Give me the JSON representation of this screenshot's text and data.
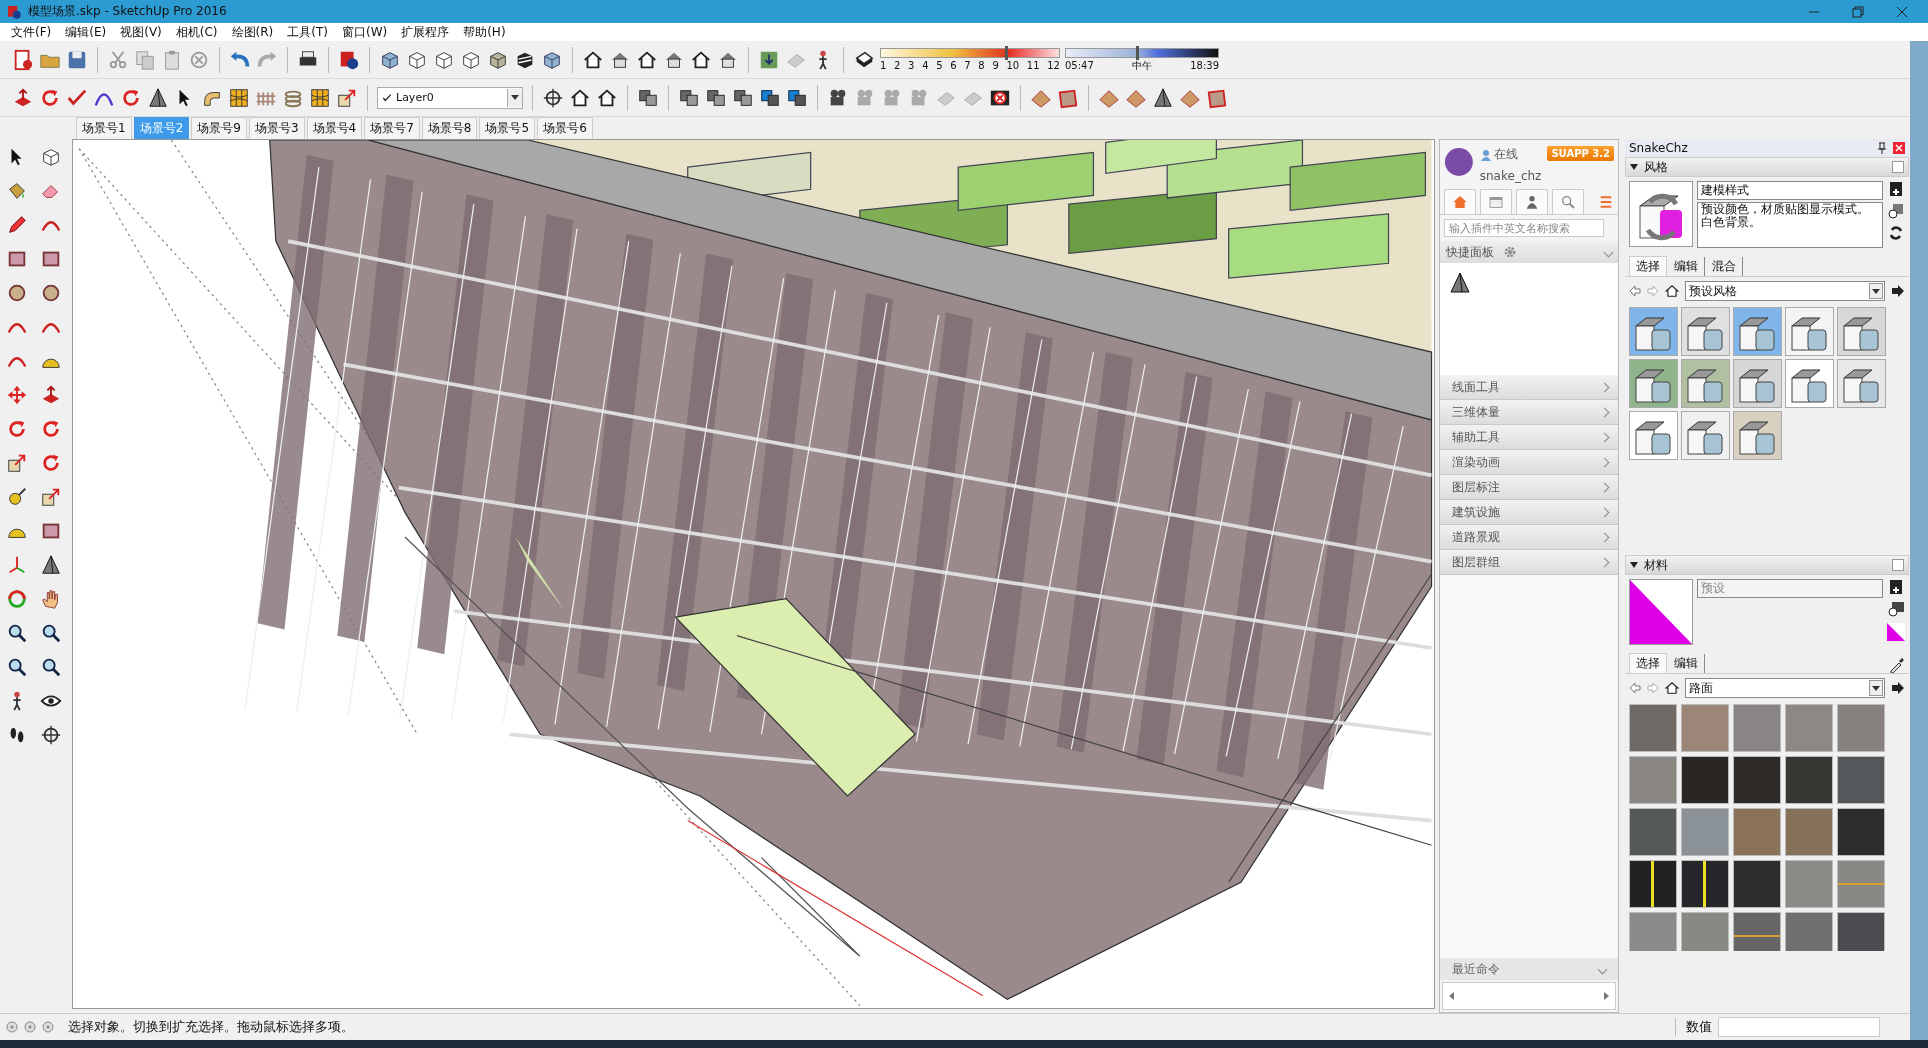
{
  "window": {
    "title": "模型场景.skp - SketchUp Pro 2016"
  },
  "menu": [
    "文件(F)",
    "编辑(E)",
    "视图(V)",
    "相机(C)",
    "绘图(R)",
    "工具(T)",
    "窗口(W)",
    "扩展程序",
    "帮助(H)"
  ],
  "toolbar": {
    "layer": "Layer0",
    "shadow_date": {
      "level": 0.7,
      "labels": [
        "1",
        "2",
        "3",
        "4",
        "5",
        "6",
        "7",
        "8",
        "9",
        "10",
        "11",
        "12"
      ]
    },
    "shadow_time": {
      "level": 0.47,
      "labels": [
        "05:47",
        "中午",
        "18:39"
      ]
    }
  },
  "scene_tabs": [
    {
      "label": "场景号1",
      "selected": false
    },
    {
      "label": "场景号2",
      "selected": true
    },
    {
      "label": "场景号9",
      "selected": false
    },
    {
      "label": "场景号3",
      "selected": false
    },
    {
      "label": "场景号4",
      "selected": false
    },
    {
      "label": "场景号7",
      "selected": false
    },
    {
      "label": "场景号8",
      "selected": false
    },
    {
      "label": "场景号5",
      "selected": false
    },
    {
      "label": "场景号6",
      "selected": false
    }
  ],
  "plugin_panel": {
    "status": "在线",
    "user": "snake_chz",
    "badge": "SUAPP 3.2",
    "search_placeholder": "输入插件中英文名称搜索",
    "quick_panel": "快捷面板",
    "categories": [
      "线面工具",
      "三维体量",
      "辅助工具",
      "渲染动画",
      "图层标注",
      "建筑设施",
      "道路景观",
      "图层群组"
    ],
    "recent": "最近命令"
  },
  "tray": {
    "title": "SnakeChz",
    "styles": {
      "header": "风格",
      "expanded": true,
      "name": "建模样式",
      "description": "预设颜色，材质贴图显示模式。白色背景。",
      "tabs": [
        {
          "label": "选择",
          "selected": true
        },
        {
          "label": "编辑",
          "selected": false
        },
        {
          "label": "混合",
          "selected": false
        }
      ],
      "collection": "预设风格"
    },
    "materials": {
      "header": "材料",
      "expanded": true,
      "name": "预设",
      "tabs": [
        {
          "label": "选择",
          "selected": true
        },
        {
          "label": "编辑",
          "selected": false
        }
      ],
      "collection": "路面"
    }
  },
  "status_bar": {
    "message": "选择对象。切换到扩充选择。拖动鼠标选择多项。",
    "measurements_label": "数值"
  }
}
